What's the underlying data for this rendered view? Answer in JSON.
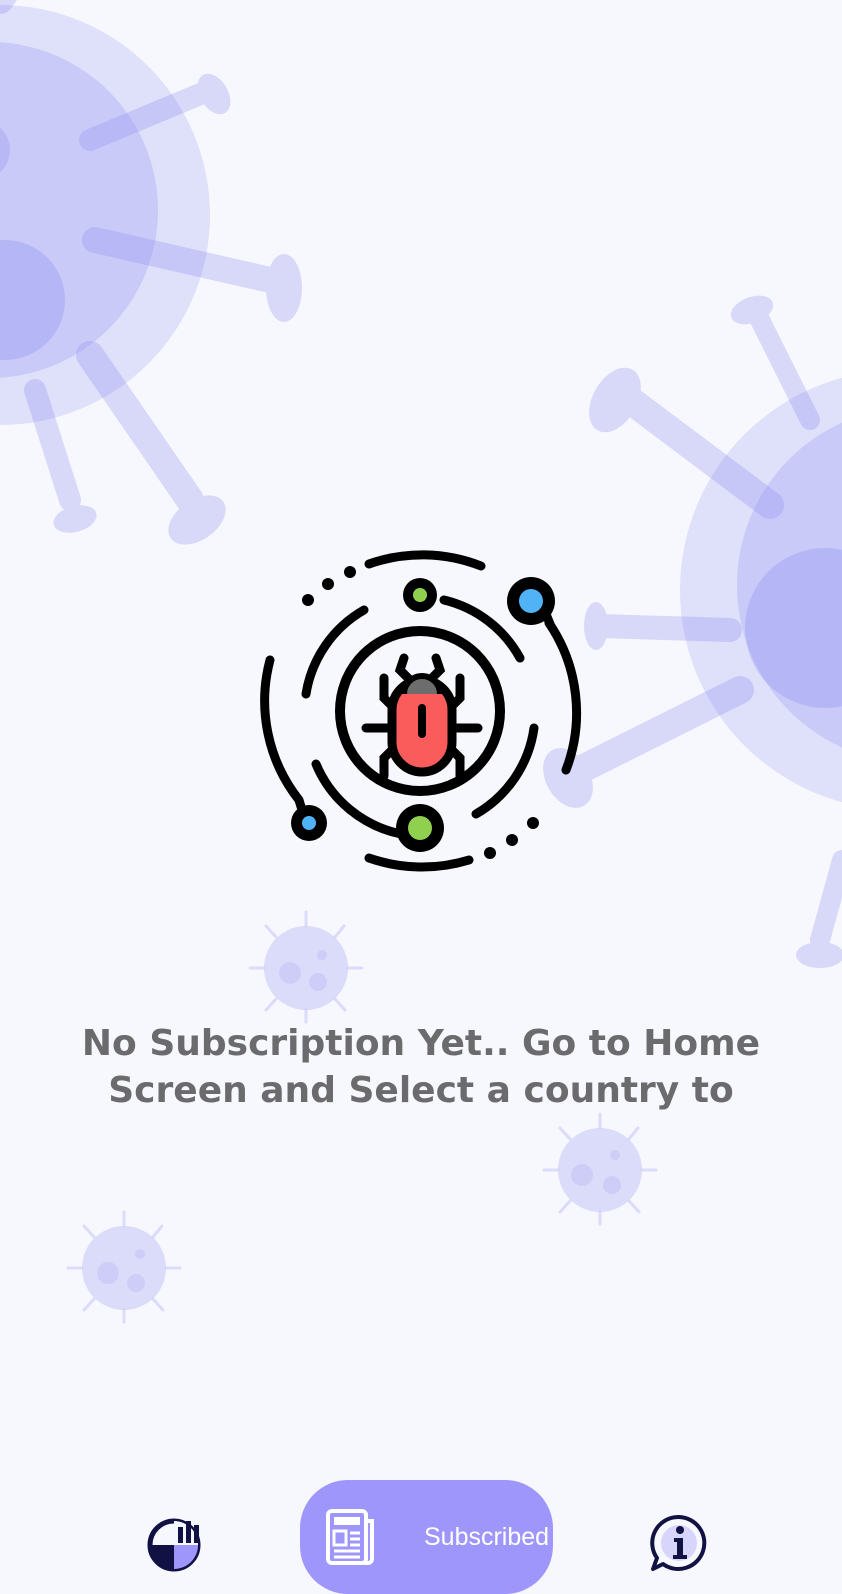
{
  "empty_state": {
    "message": "No Subscription Yet.. Go to Home Screen and Select a country to",
    "illustration_icon": "bug-radar-icon"
  },
  "bottom_nav": {
    "items": [
      {
        "id": "stats",
        "icon": "stats-chart-icon",
        "label": ""
      },
      {
        "id": "subscribed",
        "icon": "newspaper-icon",
        "label": "Subscribed",
        "active": true
      },
      {
        "id": "info",
        "icon": "info-bubble-icon",
        "label": ""
      }
    ]
  },
  "colors": {
    "background": "#f7f8fd",
    "virus": "#8f8ef0",
    "accent": "#9f96fb",
    "nav_icon": "#111144",
    "bug_body": "#fa5c5c",
    "dot_green": "#8fd14f",
    "dot_blue": "#4fb3f5",
    "text": "#6b6b6e"
  }
}
